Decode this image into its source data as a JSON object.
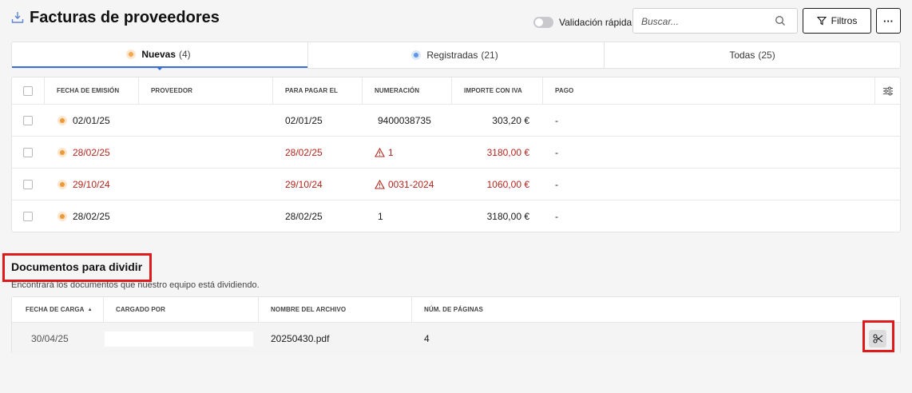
{
  "header": {
    "title": "Facturas de proveedores",
    "quick_validation_label": "Validación rápida",
    "search_placeholder": "Buscar...",
    "filters_label": "Filtros",
    "more_label": "···"
  },
  "tabs": [
    {
      "label": "Nuevas",
      "count": "(4)",
      "active": true,
      "dot": "orange"
    },
    {
      "label": "Registradas",
      "count": "(21)",
      "active": false,
      "dot": "blue"
    },
    {
      "label": "Todas",
      "count": "(25)",
      "active": false,
      "dot": null
    }
  ],
  "invoices": {
    "columns": {
      "date": "FECHA DE EMISIÓN",
      "provider": "PROVEEDOR",
      "due": "PARA PAGAR EL",
      "number": "NUMERACIÓN",
      "amount": "IMPORTE CON IVA",
      "payment": "PAGO"
    },
    "rows": [
      {
        "date": "02/01/25",
        "provider": "",
        "due": "02/01/25",
        "number": "9400038735",
        "amount": "303,20 €",
        "payment": "-",
        "warning": false
      },
      {
        "date": "28/02/25",
        "provider": "",
        "due": "28/02/25",
        "number": "1",
        "amount": "3180,00 €",
        "payment": "-",
        "warning": true
      },
      {
        "date": "29/10/24",
        "provider": "",
        "due": "29/10/24",
        "number": "0031-2024",
        "amount": "1060,00 €",
        "payment": "-",
        "warning": true
      },
      {
        "date": "28/02/25",
        "provider": "",
        "due": "28/02/25",
        "number": "1",
        "amount": "3180,00 €",
        "payment": "-",
        "warning": false
      }
    ]
  },
  "split_docs": {
    "title": "Documentos para dividir",
    "subtitle": "Encontrará los documentos que nuestro equipo está dividiendo.",
    "columns": {
      "upload_date": "FECHA DE CARGA",
      "uploaded_by": "CARGADO POR",
      "file_name": "NOMBRE DEL ARCHIVO",
      "pages": "NÚM. DE PÁGINAS"
    },
    "sort_indicator": "▲",
    "rows": [
      {
        "upload_date": "30/04/25",
        "uploaded_by": "",
        "file_name": "20250430.pdf",
        "pages": "4"
      }
    ]
  },
  "colors": {
    "accent": "#3a6fd8",
    "warning": "#b3261e",
    "highlight": "#e0191b",
    "status_new": "#ea9a3c"
  }
}
